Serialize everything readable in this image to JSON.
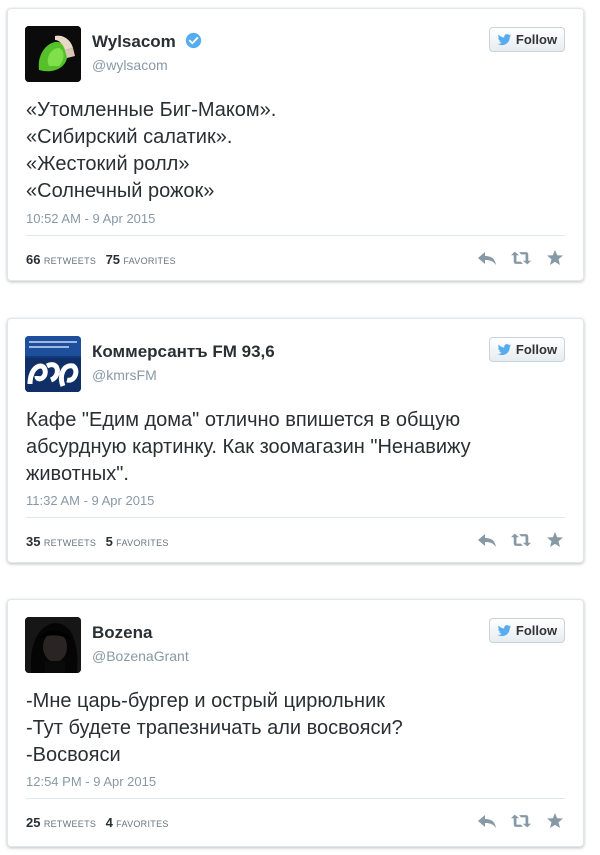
{
  "colors": {
    "handle_gray": "#8899a6",
    "text_dark": "#292f33",
    "border": "#e1e8ed",
    "twitter_blue": "#55acee",
    "action_gray": "#8899a6"
  },
  "tweets": [
    {
      "name": "Wylsacom",
      "verified": true,
      "handle": "@wylsacom",
      "follow_label": "Follow",
      "lines": [
        "«Утомленные Биг-Маком».",
        "«Сибирский салатик».",
        "«Жестокий ролл»",
        "«Солнечный рожок»"
      ],
      "timestamp": "10:52 AM - 9 Apr 2015",
      "retweets": "66",
      "retweets_label": "RETWEETS",
      "favorites": "75",
      "favorites_label": "FAVORITES"
    },
    {
      "name": "Коммерсантъ FM 93,6",
      "verified": false,
      "handle": "@kmrsFM",
      "follow_label": "Follow",
      "lines": [
        "Кафе \"Едим дома\" отлично впишется в общую",
        "абсурдную картинку. Как зоомагазин \"Ненавижу",
        "животных\"."
      ],
      "timestamp": "11:32 AM - 9 Apr 2015",
      "retweets": "35",
      "retweets_label": "RETWEETS",
      "favorites": "5",
      "favorites_label": "FAVORITES"
    },
    {
      "name": "Bozena",
      "verified": false,
      "handle": "@BozenaGrant",
      "follow_label": "Follow",
      "lines": [
        "-Мне царь-бургер и острый цирюльник",
        "-Тут будете трапезничать али восвояси?",
        "-Восвояси"
      ],
      "timestamp": "12:54 PM - 9 Apr 2015",
      "retweets": "25",
      "retweets_label": "RETWEETS",
      "favorites": "4",
      "favorites_label": "FAVORITES"
    }
  ],
  "icons": {
    "reply": "reply-icon",
    "retweet": "retweet-icon",
    "favorite": "star-icon",
    "follow": "twitter-bird-icon",
    "verified": "verified-badge-icon"
  }
}
